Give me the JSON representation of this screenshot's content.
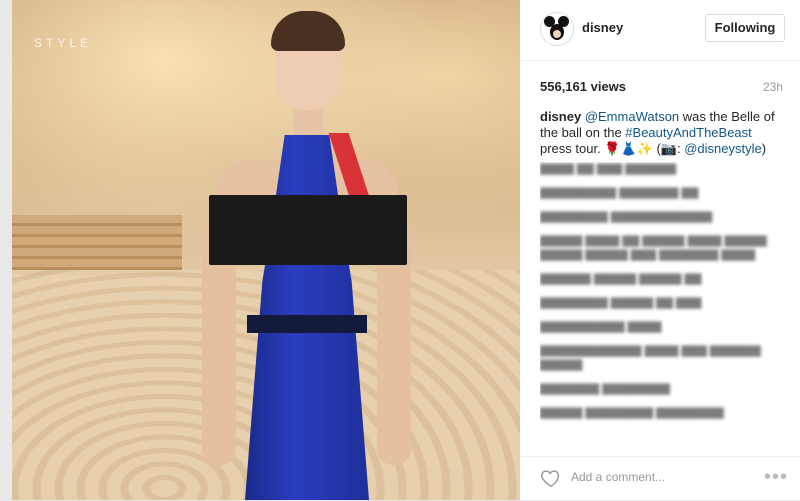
{
  "post": {
    "watermark": "STYLE",
    "account": "disney",
    "follow_label": "Following",
    "views": "556,161 views",
    "time": "23h",
    "caption": {
      "username": "disney",
      "mention": "@EmmaWatson",
      "text1": " was the Belle of the ball on the ",
      "hashtag": "#BeautyAndTheBeast",
      "text2": " press tour. 🌹👗✨ (📷: ",
      "credit": "@disneystyle",
      "text3": ")"
    }
  },
  "footer": {
    "add_comment_placeholder": "Add a comment...",
    "more_label": "•••"
  },
  "icons": {
    "heart": "heart-icon",
    "avatar": "mickey-mouse-avatar",
    "more": "more-options-icon"
  },
  "colors": {
    "link": "#125688",
    "dress": "#2a3dc0",
    "accent_red": "#d9333a"
  }
}
